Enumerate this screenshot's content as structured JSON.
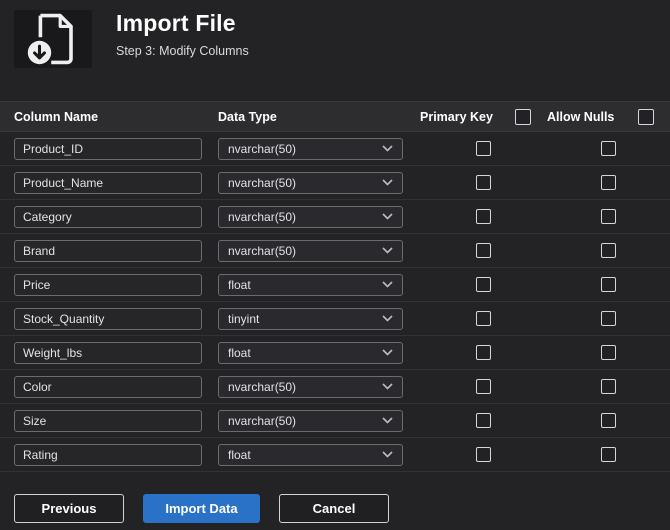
{
  "header": {
    "title": "Import File",
    "subtitle": "Step 3: Modify Columns"
  },
  "table": {
    "columns": [
      "Column Name",
      "Data Type",
      "Primary Key",
      "Allow Nulls"
    ],
    "select_all": {
      "primary_key_checked": false,
      "allow_nulls_checked": false
    },
    "rows": [
      {
        "name": "Product_ID",
        "type": "nvarchar(50)",
        "primary_key": false,
        "allow_nulls": false
      },
      {
        "name": "Product_Name",
        "type": "nvarchar(50)",
        "primary_key": false,
        "allow_nulls": false
      },
      {
        "name": "Category",
        "type": "nvarchar(50)",
        "primary_key": false,
        "allow_nulls": false
      },
      {
        "name": "Brand",
        "type": "nvarchar(50)",
        "primary_key": false,
        "allow_nulls": false
      },
      {
        "name": "Price",
        "type": "float",
        "primary_key": false,
        "allow_nulls": false
      },
      {
        "name": "Stock_Quantity",
        "type": "tinyint",
        "primary_key": false,
        "allow_nulls": false
      },
      {
        "name": "Weight_lbs",
        "type": "float",
        "primary_key": false,
        "allow_nulls": false
      },
      {
        "name": "Color",
        "type": "nvarchar(50)",
        "primary_key": false,
        "allow_nulls": false
      },
      {
        "name": "Size",
        "type": "nvarchar(50)",
        "primary_key": false,
        "allow_nulls": false
      },
      {
        "name": "Rating",
        "type": "float",
        "primary_key": false,
        "allow_nulls": false
      }
    ]
  },
  "buttons": {
    "previous": "Previous",
    "import": "Import Data",
    "cancel": "Cancel"
  },
  "colors": {
    "accent": "#2a72c8",
    "background": "#232325",
    "table_header": "#2d2d30"
  }
}
